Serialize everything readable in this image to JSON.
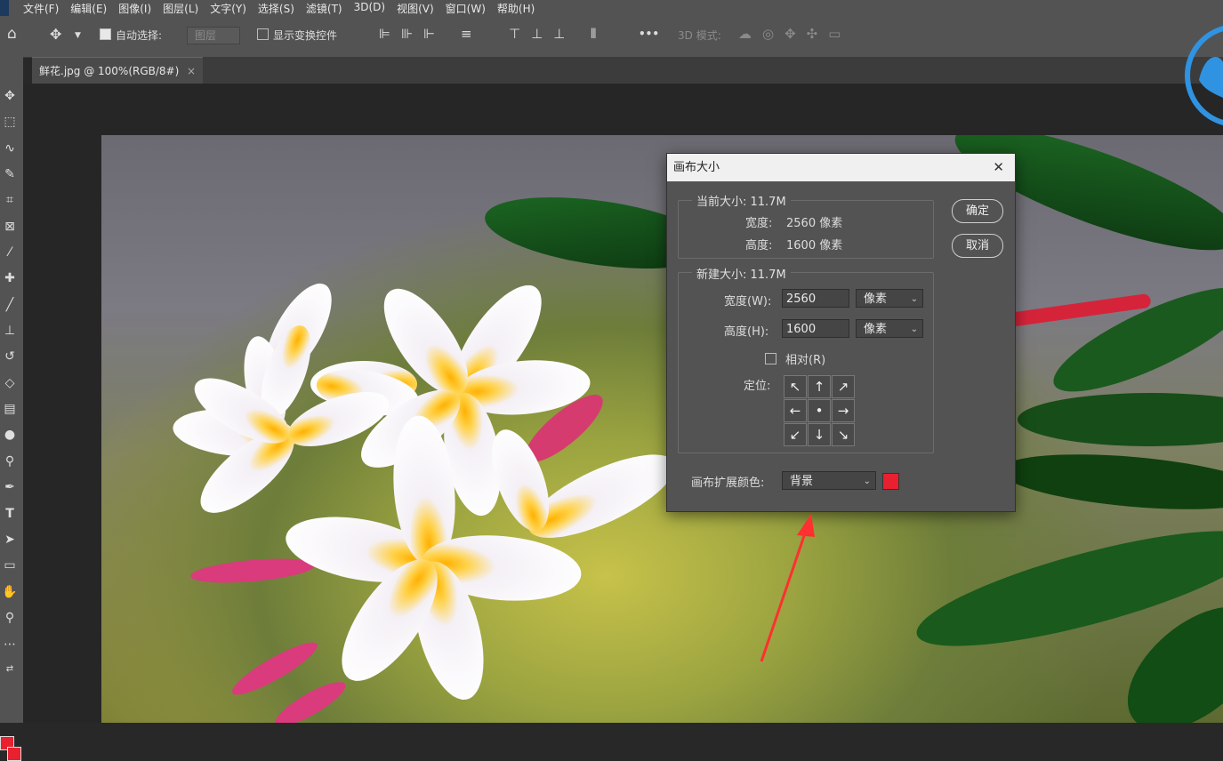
{
  "menubar": {
    "items": [
      "文件(F)",
      "编辑(E)",
      "图像(I)",
      "图层(L)",
      "文字(Y)",
      "选择(S)",
      "滤镜(T)",
      "3D(D)",
      "视图(V)",
      "窗口(W)",
      "帮助(H)"
    ]
  },
  "options": {
    "auto_select": "自动选择:",
    "layer_dropdown": "图层",
    "show_transform": "显示变换控件",
    "three_d_mode": "3D 模式:",
    "more": "•••"
  },
  "tab": {
    "label": "鲜花.jpg @ 100%(RGB/8#)",
    "close": "×"
  },
  "dialog": {
    "title": "画布大小",
    "close": "✕",
    "current": {
      "legend": "当前大小: 11.7M",
      "width_label": "宽度:",
      "width_value": "2560 像素",
      "height_label": "高度:",
      "height_value": "1600 像素"
    },
    "new": {
      "legend": "新建大小: 11.7M",
      "width_label": "宽度(W):",
      "width_value": "2560",
      "width_unit": "像素",
      "height_label": "高度(H):",
      "height_value": "1600",
      "height_unit": "像素",
      "relative_label": "相对(R)",
      "anchor_label": "定位:"
    },
    "ext_color_label": "画布扩展颜色:",
    "ext_color_value": "背景",
    "ext_color_swatch": "#e8202f",
    "ok": "确定",
    "cancel": "取消"
  },
  "colors": {
    "foreground": "#e8202f",
    "background": "#e8202f",
    "annotation_arrow": "#ff3030"
  }
}
